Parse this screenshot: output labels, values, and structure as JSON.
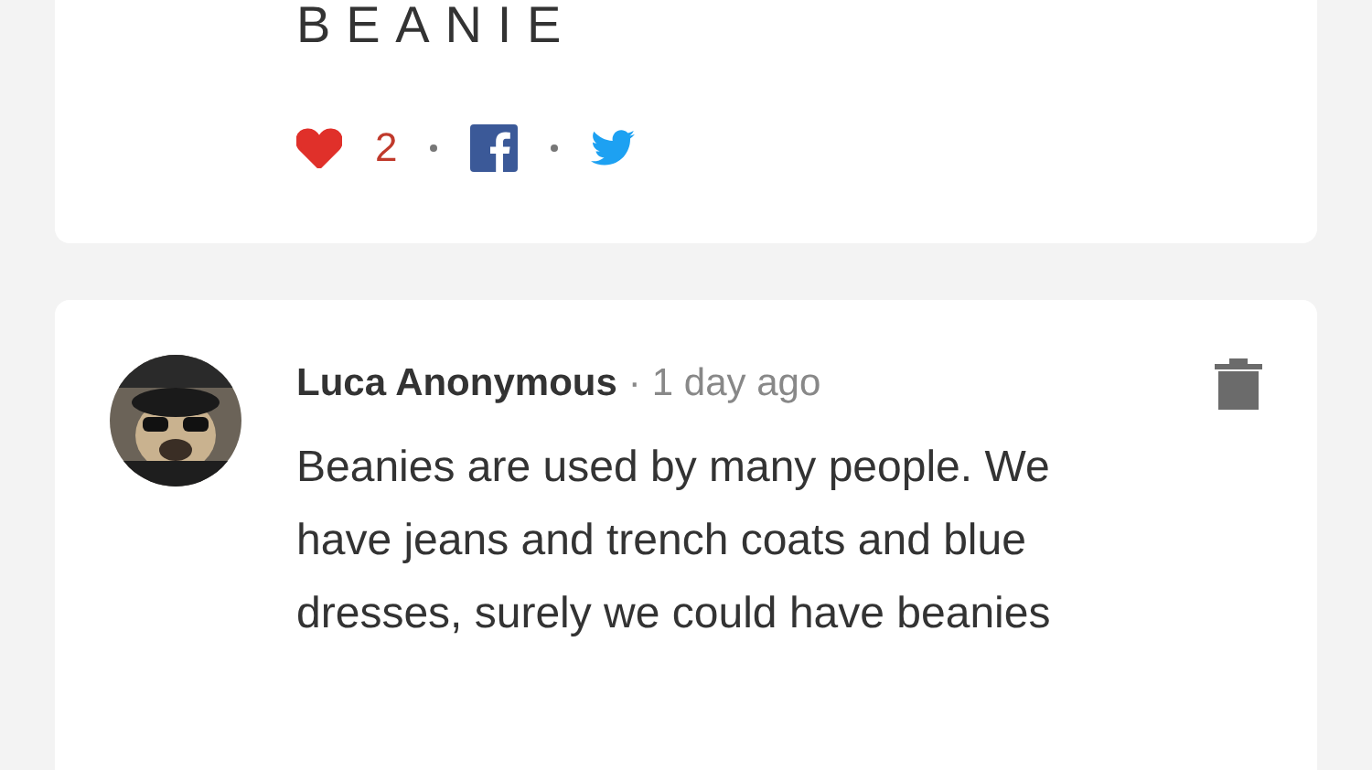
{
  "post": {
    "title": "BEANIE",
    "likes": {
      "count": "2",
      "liked": true
    },
    "share": [
      {
        "kind": "facebook"
      },
      {
        "kind": "twitter"
      }
    ]
  },
  "comment": {
    "author": "Luca Anonymous",
    "separator": "·",
    "time": "1 day ago",
    "body": "Beanies are used by many people. We have jeans and trench coats and blue dresses, surely we could have beanies"
  }
}
